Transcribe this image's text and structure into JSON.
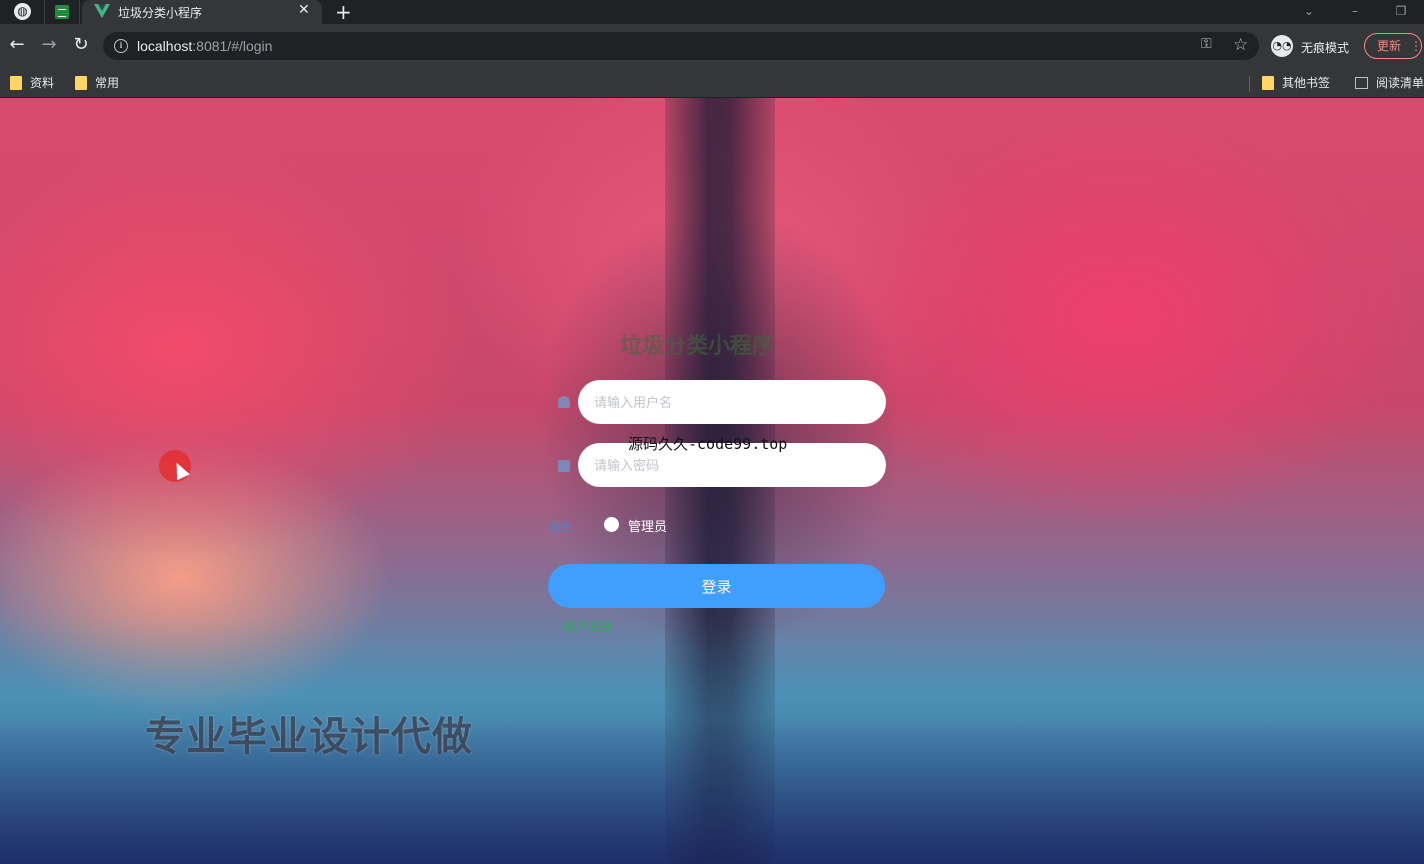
{
  "browser": {
    "tabs": [
      {
        "icon": "globe-icon"
      },
      {
        "icon": "sheets-icon"
      },
      {
        "icon": "vue-icon",
        "title": "垃圾分类小程序",
        "active": true
      }
    ],
    "new_tab": "+",
    "url_host": "localhost",
    "url_rest": ":8081/#/login",
    "incognito_label": "无痕模式",
    "update_label": "更新",
    "bookmarks_left": [
      "资料",
      "常用"
    ],
    "bookmarks_right": [
      "其他书签",
      "阅读清单"
    ]
  },
  "login": {
    "title": "垃圾分类小程序",
    "username_placeholder": "请输入用户名",
    "password_placeholder": "请输入密码",
    "role_label": "角色",
    "role_option": "管理员",
    "login_button": "登录",
    "register_link": "用户注册"
  },
  "overlay": {
    "watermark": "源码久久-code99.top",
    "promo": "专业毕业设计代做"
  },
  "colors": {
    "primary": "#409eff",
    "register": "#23b14d",
    "update": "#f28b82"
  }
}
